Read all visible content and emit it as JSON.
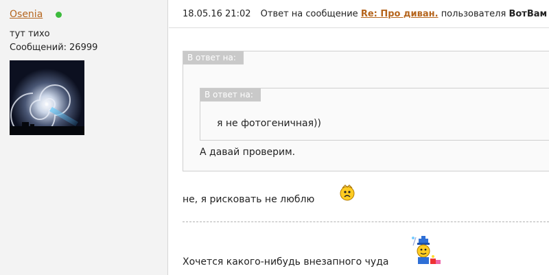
{
  "user": {
    "name": "Osenia",
    "online": true,
    "status": "тут тихо",
    "posts_label": "Сообщений:",
    "posts_count": "26999",
    "avatar": "spiral-galaxy-image"
  },
  "post": {
    "datetime": "18.05.16 21:02",
    "reply_prefix": "Ответ на сообщение",
    "topic": "Re: Про диван.",
    "by_user_prefix": "пользователя",
    "author": "ВотВам"
  },
  "quote_outer": {
    "label": "В ответ на:",
    "text": "А давай проверим."
  },
  "quote_inner": {
    "label": "В ответ на:",
    "text": "я не фотогеничная))"
  },
  "reply": {
    "text": "не, я рисковать не люблю",
    "smiley": "worried-smiley-icon"
  },
  "signature": {
    "text": "Хочется какого-нибудь внезапного чуда",
    "smiley": "fairy-smiley-icon"
  },
  "colors": {
    "link": "#b5651d",
    "online": "#3dbb3d",
    "sidebar_bg": "#f3f3f3",
    "quote_label_bg": "#c9c9c9"
  }
}
